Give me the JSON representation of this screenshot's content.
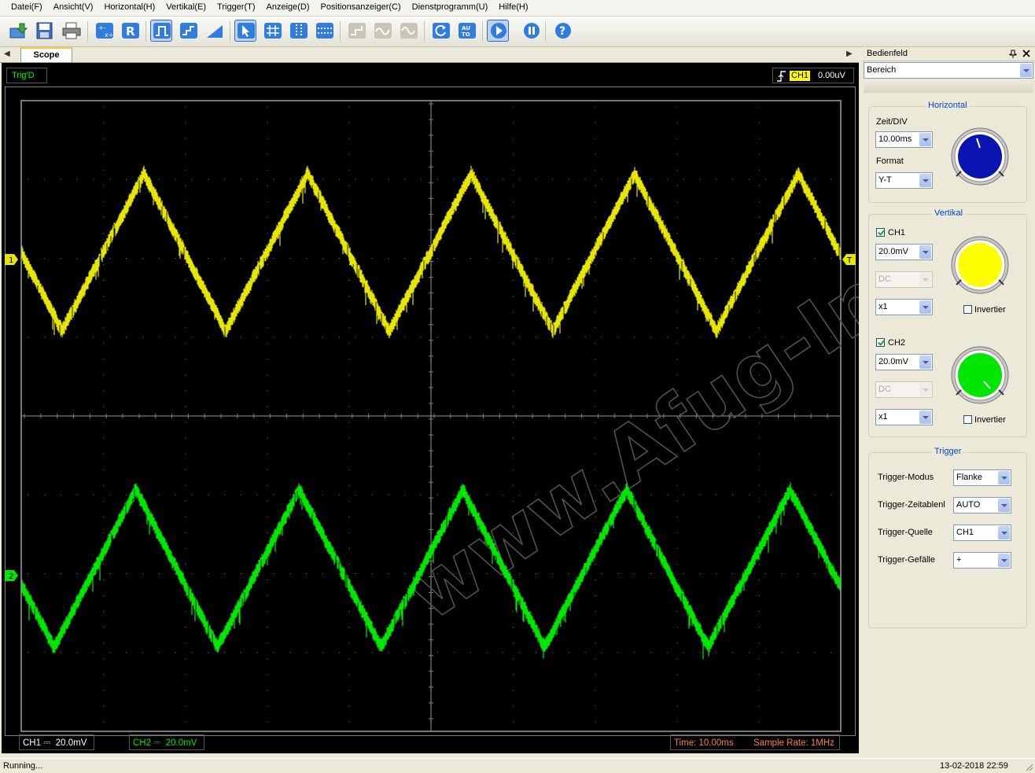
{
  "menu": [
    "Datei(F)",
    "Ansicht(V)",
    "Horizontal(H)",
    "Vertikal(E)",
    "Trigger(T)",
    "Anzeige(D)",
    "Positionsanzeiger(C)",
    "Dienstprogramm(U)",
    "Hilfe(H)"
  ],
  "tab": {
    "label": "Scope"
  },
  "scope": {
    "trig_status": "Trig'D",
    "trig_channel": "CH1",
    "trig_level": "0.00uV",
    "ch1_marker": "1",
    "ch2_marker": "2",
    "trigger_marker": "T",
    "ch1_label": "CH1 ⎓",
    "ch1_scale": "20.0mV",
    "ch2_label": "CH2 ⎓",
    "ch2_scale": "20.0mV",
    "time": "Time: 10.00ms",
    "sample_rate": "Sample Rate: 1MHz",
    "watermark": "www.Afug-Info.de",
    "colors": {
      "ch1": "#e6e600",
      "ch2": "#00e600",
      "grid": "#7a7a7a"
    }
  },
  "panel": {
    "title": "Bedienfeld",
    "selector": "Bereich",
    "horizontal": {
      "title": "Horizontal",
      "zeit_label": "Zeit/DIV",
      "zeit_value": "10.00ms",
      "format_label": "Format",
      "format_value": "Y-T"
    },
    "vertikal": {
      "title": "Vertikal",
      "ch1": {
        "label": "CH1",
        "volts": "20.0mV",
        "coupling": "DC",
        "probe": "x1",
        "invert": "Invertier"
      },
      "ch2": {
        "label": "CH2",
        "volts": "20.0mV",
        "coupling": "DC",
        "probe": "x1",
        "invert": "Invertier"
      }
    },
    "trigger": {
      "title": "Trigger",
      "rows": [
        {
          "label": "Trigger-Modus",
          "value": "Flanke"
        },
        {
          "label": "Trigger-Zeitablenl",
          "value": "AUTO"
        },
        {
          "label": "Trigger-Quelle",
          "value": "CH1"
        },
        {
          "label": "Trigger-Gefälle",
          "value": "+"
        }
      ]
    }
  },
  "status": {
    "left": "Running...",
    "right": "13-02-2018  22:59"
  }
}
